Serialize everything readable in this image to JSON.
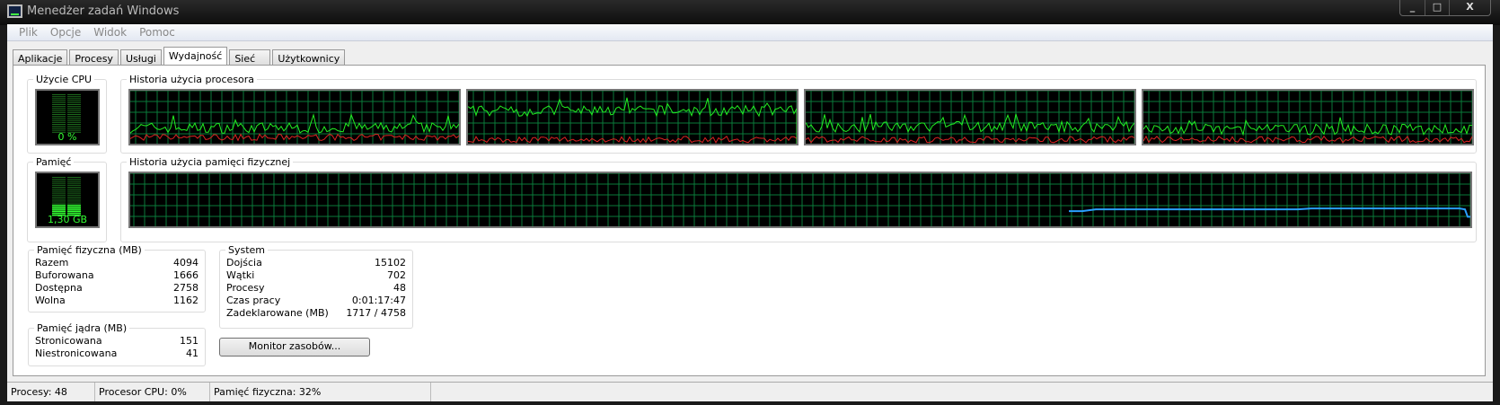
{
  "window": {
    "title": "Menedżer zadań Windows",
    "controls": {
      "minimize": "_",
      "maximize": "□",
      "close": "X"
    }
  },
  "menu": [
    "Plik",
    "Opcje",
    "Widok",
    "Pomoc"
  ],
  "tabs": [
    "Aplikacje",
    "Procesy",
    "Usługi",
    "Wydajność",
    "Sieć",
    "Użytkownicy"
  ],
  "active_tab": 3,
  "cpu": {
    "label": "Użycie CPU",
    "value": "0 %",
    "percent": 0,
    "history_label": "Historia użycia procesora",
    "cores": 4
  },
  "memory": {
    "label": "Pamięć",
    "value": "1,30 GB",
    "percent": 32,
    "history_label": "Historia użycia pamięci fizycznej"
  },
  "physical": {
    "title": "Pamięć fizyczna (MB)",
    "rows": [
      [
        "Razem",
        "4094"
      ],
      [
        "Buforowana",
        "1666"
      ],
      [
        "Dostępna",
        "2758"
      ],
      [
        "Wolna",
        "1162"
      ]
    ]
  },
  "kernel": {
    "title": "Pamięć jądra (MB)",
    "rows": [
      [
        "Stronicowana",
        "151"
      ],
      [
        "Niestronicowana",
        "41"
      ]
    ]
  },
  "system": {
    "title": "System",
    "rows": [
      [
        "Dojścia",
        "15102"
      ],
      [
        "Wątki",
        "702"
      ],
      [
        "Procesy",
        "48"
      ],
      [
        "Czas pracy",
        "0:01:17:47"
      ],
      [
        "Zadeklarowane (MB)",
        "1717 / 4758"
      ]
    ]
  },
  "resource_monitor_button": "Monitor zasobów...",
  "statusbar": [
    "Procesy: 48",
    "Procesor CPU: 0%",
    "Pamięć fizyczna: 32%"
  ],
  "colors": {
    "grid": "#0a7a3a",
    "cpu": "#22ee22",
    "kernel": "#dd2222",
    "mem": "#2a9fff"
  }
}
